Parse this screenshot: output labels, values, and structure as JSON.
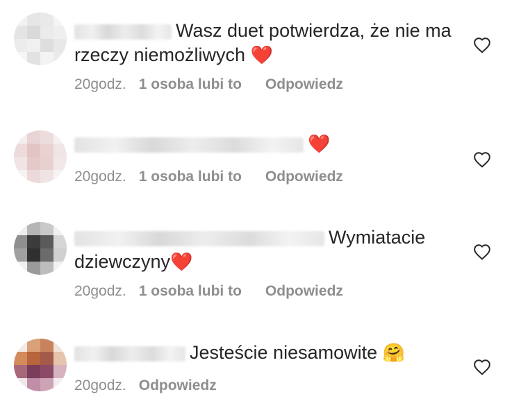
{
  "comments": [
    {
      "text": "Wasz duet potwierdza, że nie ma rzeczy niemożliwych",
      "emoji": "❤️",
      "time": "20godz.",
      "likes": "1 osoba lubi to",
      "reply": "Odpowiedz"
    },
    {
      "text": "",
      "emoji": "❤️",
      "time": "20godz.",
      "likes": "1 osoba lubi to",
      "reply": "Odpowiedz"
    },
    {
      "text": "Wymiatacie dziewczyny",
      "emoji": "❤️",
      "time": "20godz.",
      "likes": "1 osoba lubi to",
      "reply": "Odpowiedz"
    },
    {
      "text": "Jesteście niesamowite",
      "emoji": "🤗",
      "time": "20godz.",
      "reply": "Odpowiedz"
    }
  ],
  "icons": {
    "like": "heart-outline-icon"
  },
  "colors": {
    "text": "#262626",
    "meta": "#8e8e8e",
    "heart": "#e0182d"
  }
}
